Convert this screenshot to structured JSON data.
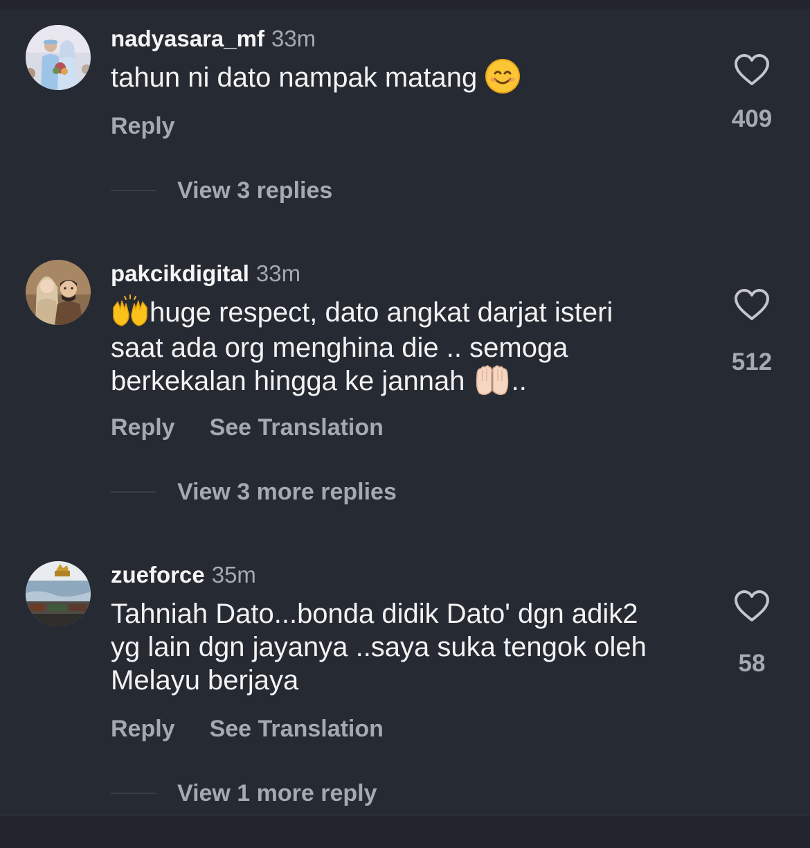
{
  "comments": [
    {
      "username": "nadyasara_mf",
      "time": "33m",
      "text": "tahun ni dato nampak matang ",
      "emoji": "smiling-face-emoji",
      "actions": {
        "reply": "Reply"
      },
      "likes": "409",
      "replies_link": "View 3 replies"
    },
    {
      "username": "pakcikdigital",
      "time": "33m",
      "text_line1": "huge respect, dato angkat darjat isteri",
      "text_line2": "saat ada org menghina die .. semoga",
      "text_line3": "berkekalan hingga ke jannah ",
      "text_line3_suffix": "..",
      "emoji_start": "raising-hands-emoji",
      "emoji_end": "palms-up-together-emoji",
      "actions": {
        "reply": "Reply",
        "translate": "See Translation"
      },
      "likes": "512",
      "replies_link": "View 3 more replies"
    },
    {
      "username": "zueforce",
      "time": "35m",
      "text_line1": "Tahniah Dato...bonda didik Dato' dgn adik2",
      "text_line2": "yg lain dgn jayanya ..saya suka tengok oleh",
      "text_line3": "Melayu berjaya",
      "actions": {
        "reply": "Reply",
        "translate": "See Translation"
      },
      "likes": "58",
      "replies_link": "View 1 more reply"
    }
  ],
  "icons": {
    "like": "heart-outline-icon",
    "avatar": "avatar"
  },
  "colors": {
    "background": "#262a33",
    "primary_text": "#f2f2f2",
    "secondary_text": "#a6a9b0",
    "divider": "#3a3e47"
  }
}
